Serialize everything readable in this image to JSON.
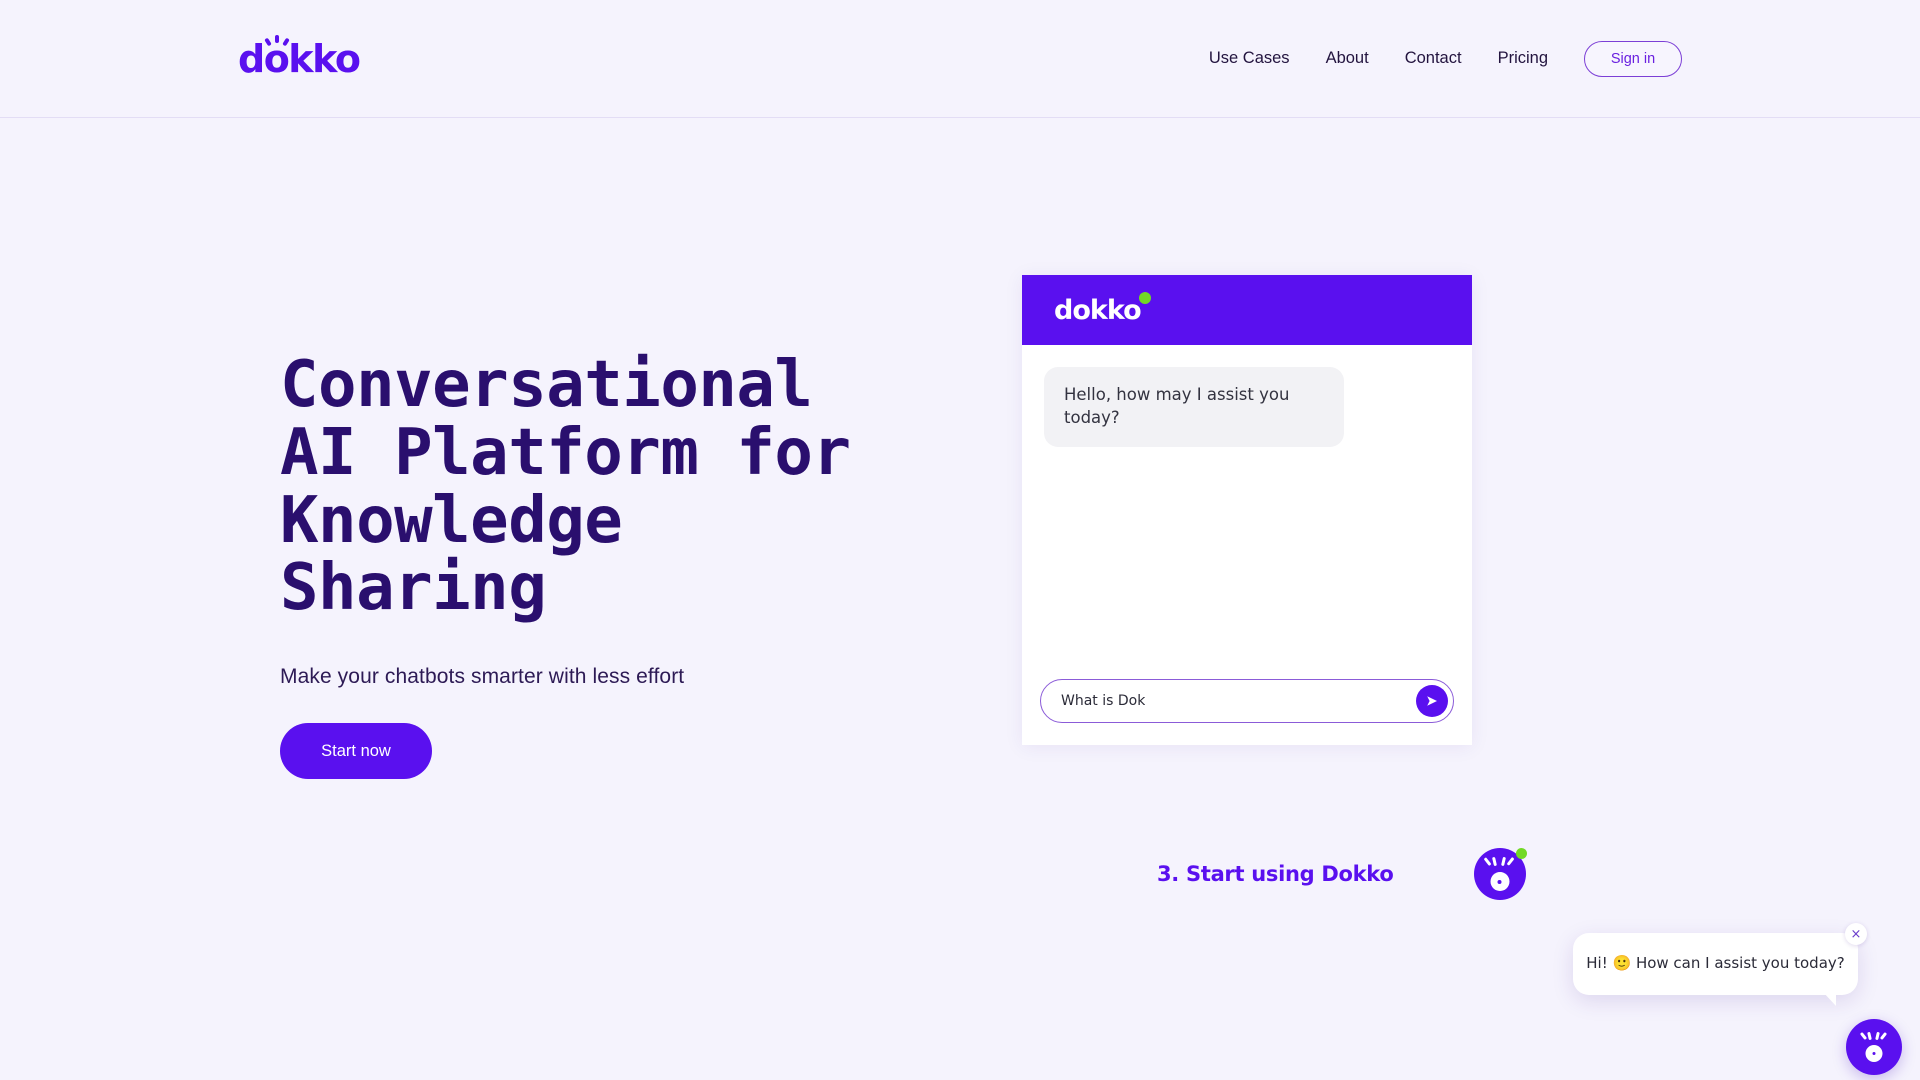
{
  "brand": {
    "accent_purple": "#5a10ef",
    "headline_navy": "#2a0f6e",
    "status_green": "#72d926",
    "page_background": "#f5f3fd",
    "logo_text": "dokko"
  },
  "header": {
    "logo_text": "dokko",
    "nav": [
      {
        "label": "Use Cases"
      },
      {
        "label": "About"
      },
      {
        "label": "Contact"
      },
      {
        "label": "Pricing"
      }
    ],
    "signin_label": "Sign in"
  },
  "hero": {
    "title": "Conversational\nAI Platform for\nKnowledge\nSharing",
    "subtitle": "Make your chatbots smarter with less effort",
    "cta_label": "Start now"
  },
  "chat_widget": {
    "header_logo_text": "dokko",
    "messages": [
      {
        "author": "bot",
        "text": "Hello, how may I assist you today?"
      }
    ],
    "input_value": "What is Dok",
    "send_icon": "send-arrow-icon"
  },
  "step": {
    "label": "3. Start using Dokko",
    "avatar_icon": "dokko-mark-icon"
  },
  "floating": {
    "tooltip_text": "Hi! 🙂 How can I assist you today?",
    "close_label": "×",
    "launcher_icon": "dokko-mark-icon"
  }
}
